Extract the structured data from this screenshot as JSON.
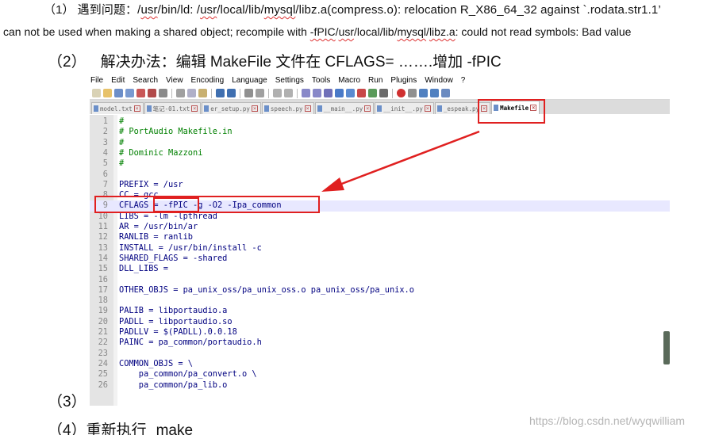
{
  "problem_line": {
    "number": "（1）",
    "text_a": "遇到问题：/",
    "p_usr": "usr",
    "text_b": "/bin/ld: /",
    "p_usr2": "usr",
    "text_c": "/local/lib/",
    "p_mysql": "mysql",
    "text_d": "/libz.a(compress.o): relocation R_X86_64_32 against `.rodata.str1.1’",
    "line2_a": "can not be used when making a shared object; recompile with ",
    "line2_fpic": "-fPIC",
    "line2_b": "/",
    "line2_usr": "usr",
    "line2_c": "/local/lib/",
    "line2_mysql": "mysql",
    "line2_d": "/",
    "line2_libz": "libz.a",
    "line2_e": ": could not read symbols: Bad value"
  },
  "solution_line": {
    "number": "（2）",
    "text": "解决办法：编辑 MakeFile 文件在 CFLAGS= …….增加 -fPIC"
  },
  "step3": {
    "number": "（3）"
  },
  "step4": {
    "number": "（4）",
    "text": "重新执行",
    "cmd": "make"
  },
  "editor": {
    "menu": [
      "File",
      "Edit",
      "Search",
      "View",
      "Encoding",
      "Language",
      "Settings",
      "Tools",
      "Macro",
      "Run",
      "Plugins",
      "Window",
      "?"
    ],
    "tabs": [
      "model.txt",
      "笔记-01.txt",
      "er_setup.py",
      "speech.py",
      "__main__.py",
      "__init__.py",
      "_espeak.py",
      "Makefile"
    ],
    "active_tab": "Makefile",
    "lines": [
      {
        "n": "1",
        "t": "#",
        "k": "com"
      },
      {
        "n": "2",
        "t": "# PortAudio Makefile.in",
        "k": "com"
      },
      {
        "n": "3",
        "t": "#",
        "k": "com"
      },
      {
        "n": "4",
        "t": "# Dominic Mazzoni",
        "k": "com"
      },
      {
        "n": "5",
        "t": "#",
        "k": "com"
      },
      {
        "n": "6",
        "t": "",
        "k": "com"
      },
      {
        "n": "7",
        "t": "PREFIX = /usr",
        "k": "var"
      },
      {
        "n": "8",
        "t": "CC = gcc",
        "k": "var"
      },
      {
        "n": "9",
        "t": "CFLAGS = -fPIC -g -O2 -Ipa_common",
        "k": "var"
      },
      {
        "n": "10",
        "t": "LIBS = -lm -lpthread",
        "k": "var"
      },
      {
        "n": "11",
        "t": "AR = /usr/bin/ar",
        "k": "var"
      },
      {
        "n": "12",
        "t": "RANLIB = ranlib",
        "k": "var"
      },
      {
        "n": "13",
        "t": "INSTALL = /usr/bin/install -c",
        "k": "var"
      },
      {
        "n": "14",
        "t": "SHARED_FLAGS = -shared",
        "k": "var"
      },
      {
        "n": "15",
        "t": "DLL_LIBS =",
        "k": "var"
      },
      {
        "n": "16",
        "t": "",
        "k": "var"
      },
      {
        "n": "17",
        "t": "OTHER_OBJS = pa_unix_oss/pa_unix_oss.o pa_unix_oss/pa_unix.o",
        "k": "var"
      },
      {
        "n": "18",
        "t": "",
        "k": "var"
      },
      {
        "n": "19",
        "t": "PALIB = libportaudio.a",
        "k": "var"
      },
      {
        "n": "20",
        "t": "PADLL = libportaudio.so",
        "k": "var"
      },
      {
        "n": "21",
        "t": "PADLLV = $(PADLL).0.0.18",
        "k": "var"
      },
      {
        "n": "22",
        "t": "PAINC = pa_common/portaudio.h",
        "k": "var"
      },
      {
        "n": "23",
        "t": "",
        "k": "var"
      },
      {
        "n": "24",
        "t": "COMMON_OBJS = \\",
        "k": "var"
      },
      {
        "n": "25",
        "t": "    pa_common/pa_convert.o \\",
        "k": "var"
      },
      {
        "n": "26",
        "t": "    pa_common/pa_lib.o",
        "k": "var"
      }
    ],
    "highlight_line": 9
  },
  "watermark": "https://blog.csdn.net/wyqwilliam",
  "colors": {
    "annotation_red": "#e02020",
    "comment": "#008000",
    "variable": "#000080",
    "current_line": "#e8e8ff"
  }
}
